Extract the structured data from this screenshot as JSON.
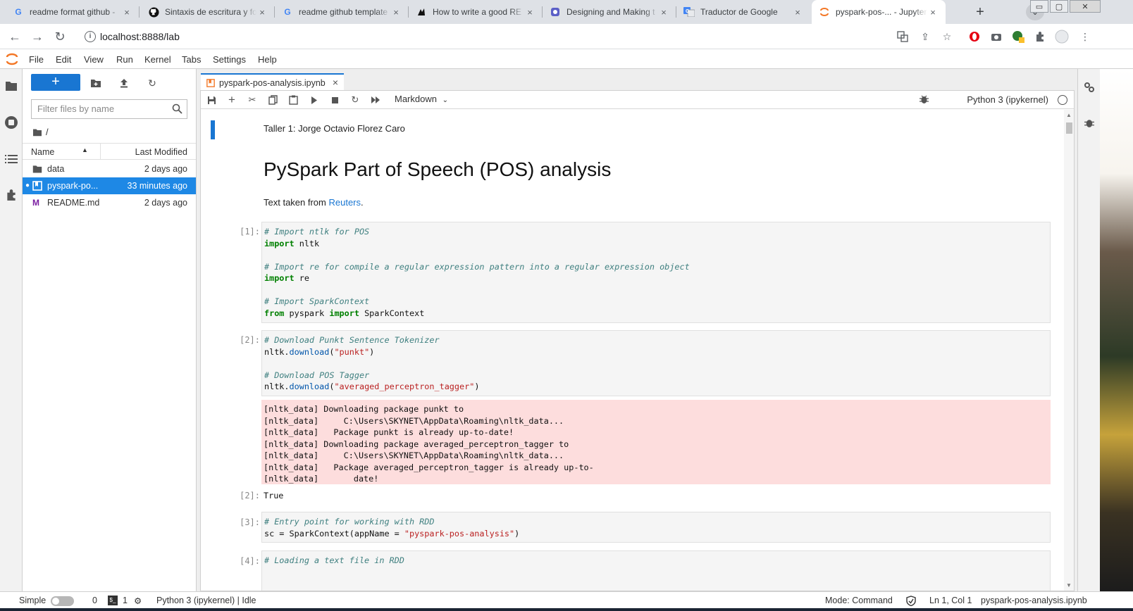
{
  "browser": {
    "tabs": [
      {
        "favicon": "G",
        "title": "readme format github -",
        "active": false
      },
      {
        "favicon": "github",
        "title": "Sintaxis de escritura y fo",
        "active": false
      },
      {
        "favicon": "G",
        "title": "readme github template",
        "active": false
      },
      {
        "favicon": "web-icon",
        "title": "How to write a good RE",
        "active": false
      },
      {
        "favicon": "web-icon",
        "title": "Designing and Making t",
        "active": false
      },
      {
        "favicon": "translate-icon",
        "title": "Traductor de Google",
        "active": false
      },
      {
        "favicon": "jupyter-icon",
        "title": "pyspark-pos-... - Jupyter",
        "active": true
      }
    ],
    "close_glyph": "×",
    "new_tab": "+",
    "url": "localhost:8888/lab",
    "window_controls": {
      "minimize": "▭",
      "maximize": "▢",
      "close": "✕"
    }
  },
  "menubar": {
    "items": [
      "File",
      "Edit",
      "View",
      "Run",
      "Kernel",
      "Tabs",
      "Settings",
      "Help"
    ]
  },
  "filebrowser": {
    "new_button": "+",
    "filter_placeholder": "Filter files by name",
    "breadcrumb": "/",
    "columns": {
      "name": "Name",
      "modified": "Last Modified"
    },
    "files": [
      {
        "name": "data",
        "modified": "2 days ago",
        "type": "folder",
        "selected": false
      },
      {
        "name": "pyspark-po...",
        "modified": "33 minutes ago",
        "type": "notebook",
        "selected": true,
        "running": true
      },
      {
        "name": "README.md",
        "modified": "2 days ago",
        "type": "markdown",
        "selected": false
      }
    ]
  },
  "notebook": {
    "tab_title": "pyspark-pos-analysis.ipynb",
    "cell_type": "Markdown",
    "kernel": "Python 3 (ipykernel)",
    "author_line": "Taller 1: Jorge Octavio Florez Caro",
    "heading": "PySpark Part of Speech (POS) analysis",
    "text_prefix": "Text taken from ",
    "text_link": "Reuters",
    "text_suffix": ".",
    "cells": [
      {
        "prompt": "[1]:"
      },
      {
        "prompt": "[2]:",
        "stderr": "[nltk_data] Downloading package punkt to\n[nltk_data]     C:\\Users\\SKYNET\\AppData\\Roaming\\nltk_data...\n[nltk_data]   Package punkt is already up-to-date!\n[nltk_data] Downloading package averaged_perceptron_tagger to\n[nltk_data]     C:\\Users\\SKYNET\\AppData\\Roaming\\nltk_data...\n[nltk_data]   Package averaged_perceptron_tagger is already up-to-\n[nltk_data]       date!",
        "out_prompt": "[2]:",
        "out_text": "True"
      },
      {
        "prompt": "[3]:"
      },
      {
        "prompt": "[4]:"
      }
    ]
  },
  "statusbar": {
    "mode_label": "Simple",
    "kernels": "0",
    "terminals": "1",
    "kernel_status": "Python 3 (ipykernel) | Idle",
    "mode": "Mode: Command",
    "cursor": "Ln 1, Col 1",
    "filename": "pyspark-pos-analysis.ipynb"
  },
  "colors": {
    "accent": "#1976d2",
    "stderr_bg": "#fddddd",
    "selected_row": "#1e88e5"
  }
}
